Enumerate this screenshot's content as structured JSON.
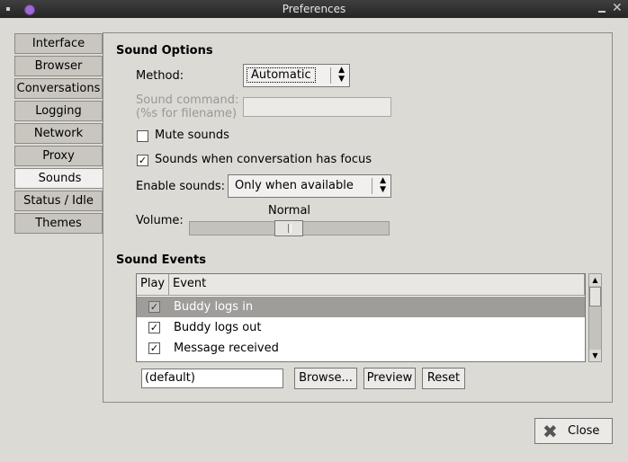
{
  "window": {
    "title": "Preferences"
  },
  "tabs": [
    {
      "label": "Interface"
    },
    {
      "label": "Browser"
    },
    {
      "label": "Conversations"
    },
    {
      "label": "Logging"
    },
    {
      "label": "Network"
    },
    {
      "label": "Proxy"
    },
    {
      "label": "Sounds",
      "active": true
    },
    {
      "label": "Status / Idle"
    },
    {
      "label": "Themes"
    }
  ],
  "sound_options": {
    "title": "Sound Options",
    "method_label": "Method:",
    "method_value": "Automatic",
    "command_label_line1": "Sound command:",
    "command_label_line2": "(%s for filename)",
    "command_value": "",
    "mute_label": "Mute sounds",
    "mute_checked": false,
    "focus_label": "Sounds when conversation has focus",
    "focus_checked": true,
    "enable_label": "Enable sounds:",
    "enable_value": "Only when available",
    "volume_label": "Volume:",
    "volume_value_label": "Normal",
    "volume_fraction": 0.5
  },
  "sound_events": {
    "title": "Sound Events",
    "columns": [
      "Play",
      "Event"
    ],
    "rows": [
      {
        "play": true,
        "event": "Buddy logs in",
        "selected": true
      },
      {
        "play": true,
        "event": "Buddy logs out"
      },
      {
        "play": true,
        "event": "Message received"
      }
    ],
    "file_value": "(default)",
    "browse_label": "Browse...",
    "preview_label": "Preview",
    "reset_label": "Reset"
  },
  "footer": {
    "close_label": "Close"
  },
  "icons": {
    "close": "close-x-icon",
    "check": "✓",
    "combo_arrows": "updown-icon"
  }
}
